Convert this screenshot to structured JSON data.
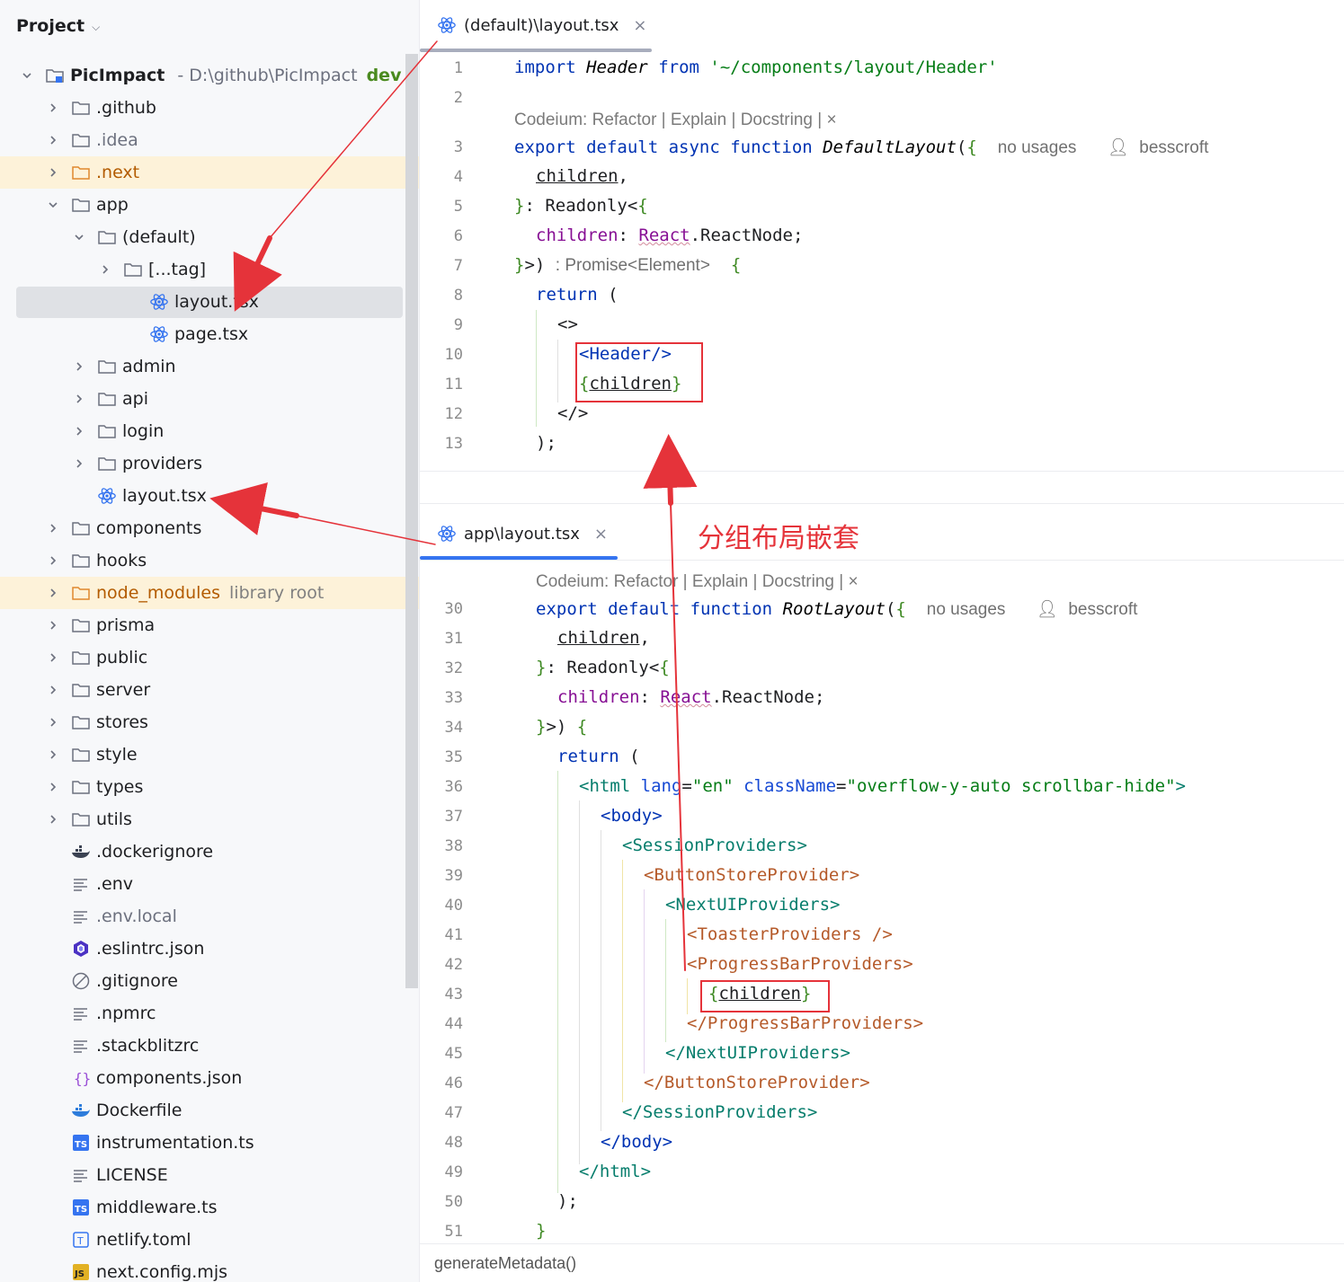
{
  "project_panel": {
    "title": "Project",
    "root": {
      "name": "PicImpact",
      "path": "- D:\\github\\PicImpact",
      "branch": "dev /",
      "status": "Ø"
    },
    "items": [
      {
        "label": ".github",
        "type": "folder"
      },
      {
        "label": ".idea",
        "type": "folder",
        "muted": true
      },
      {
        "label": ".next",
        "type": "folder",
        "highlight": true
      },
      {
        "label": "app",
        "type": "folder",
        "expanded": true
      },
      {
        "label": "(default)",
        "type": "folder",
        "expanded": true
      },
      {
        "label": "[...tag]",
        "type": "folder"
      },
      {
        "label": "layout.tsx",
        "type": "react",
        "selected": true
      },
      {
        "label": "page.tsx",
        "type": "react"
      },
      {
        "label": "admin",
        "type": "folder"
      },
      {
        "label": "api",
        "type": "folder"
      },
      {
        "label": "login",
        "type": "folder"
      },
      {
        "label": "providers",
        "type": "folder"
      },
      {
        "label": "layout.tsx",
        "type": "react"
      },
      {
        "label": "components",
        "type": "folder"
      },
      {
        "label": "hooks",
        "type": "folder"
      },
      {
        "label": "node_modules",
        "type": "folder",
        "highlight": true,
        "extra": "library root"
      },
      {
        "label": "prisma",
        "type": "folder"
      },
      {
        "label": "public",
        "type": "folder"
      },
      {
        "label": "server",
        "type": "folder"
      },
      {
        "label": "stores",
        "type": "folder"
      },
      {
        "label": "style",
        "type": "folder"
      },
      {
        "label": "types",
        "type": "folder"
      },
      {
        "label": "utils",
        "type": "folder"
      },
      {
        "label": ".dockerignore",
        "type": "docker"
      },
      {
        "label": ".env",
        "type": "text"
      },
      {
        "label": ".env.local",
        "type": "text",
        "muted": true
      },
      {
        "label": ".eslintrc.json",
        "type": "eslint"
      },
      {
        "label": ".gitignore",
        "type": "gitignore"
      },
      {
        "label": ".npmrc",
        "type": "text"
      },
      {
        "label": ".stackblitzrc",
        "type": "text"
      },
      {
        "label": "components.json",
        "type": "json"
      },
      {
        "label": "Dockerfile",
        "type": "docker"
      },
      {
        "label": "instrumentation.ts",
        "type": "ts"
      },
      {
        "label": "LICENSE",
        "type": "text"
      },
      {
        "label": "middleware.ts",
        "type": "ts"
      },
      {
        "label": "netlify.toml",
        "type": "toml"
      },
      {
        "label": "next.config.mjs",
        "type": "js"
      }
    ]
  },
  "top_editor": {
    "tab_label": "(default)\\layout.tsx",
    "close": "×",
    "line_numbers": [
      "1",
      "2",
      "3",
      "4",
      "5",
      "6",
      "7",
      "8",
      "9",
      "10",
      "11",
      "12",
      "13"
    ],
    "lens": "Codeium: Refactor | Explain | Docstring | ×",
    "inlay_usages": "no usages",
    "inlay_author": "besscroft",
    "inlay_return_type": ": Promise<Element>"
  },
  "bottom_editor": {
    "tab_label": "app\\layout.tsx",
    "close": "×",
    "line_numbers": [
      "30",
      "31",
      "32",
      "33",
      "34",
      "35",
      "36",
      "37",
      "38",
      "39",
      "40",
      "41",
      "42",
      "43",
      "44",
      "45",
      "46",
      "47",
      "48",
      "49",
      "50",
      "51"
    ],
    "lens": "Codeium: Refactor | Explain | Docstring | ×",
    "inlay_usages": "no usages",
    "inlay_author": "besscroft"
  },
  "annotation": "分组布局嵌套",
  "breadcrumb": "generateMetadata()",
  "colors": {
    "accent": "#3574f0",
    "annotation_red": "#e5333a",
    "highlight_row": "#fdf2d9"
  }
}
